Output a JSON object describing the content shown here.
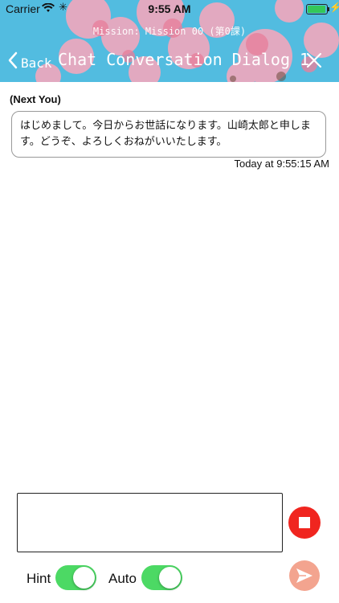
{
  "status_bar": {
    "carrier": "Carrier",
    "time": "9:55 AM"
  },
  "header": {
    "mission": "Mission: Mission 00 (第0課)",
    "back_label": "Back",
    "title": "Chat Conversation Dialog 1"
  },
  "chat": {
    "messages": [
      {
        "speaker": "(Next You)",
        "text": "はじめまして。今日からお世話になります。山崎太郎と申します。どうぞ、よろしくおねがいいたします。",
        "timestamp": "Today at 9:55:15 AM"
      }
    ]
  },
  "controls": {
    "input_value": "",
    "hint_label": "Hint",
    "hint_on": true,
    "auto_label": "Auto",
    "auto_on": true
  },
  "colors": {
    "header_bg": "#52bce0",
    "toggle_on": "#4cd964",
    "stop": "#f0251f",
    "send": "#f3a48f"
  },
  "icons": {
    "back": "chevron-left-icon",
    "close": "close-icon",
    "stop": "stop-icon",
    "send": "send-icon"
  }
}
